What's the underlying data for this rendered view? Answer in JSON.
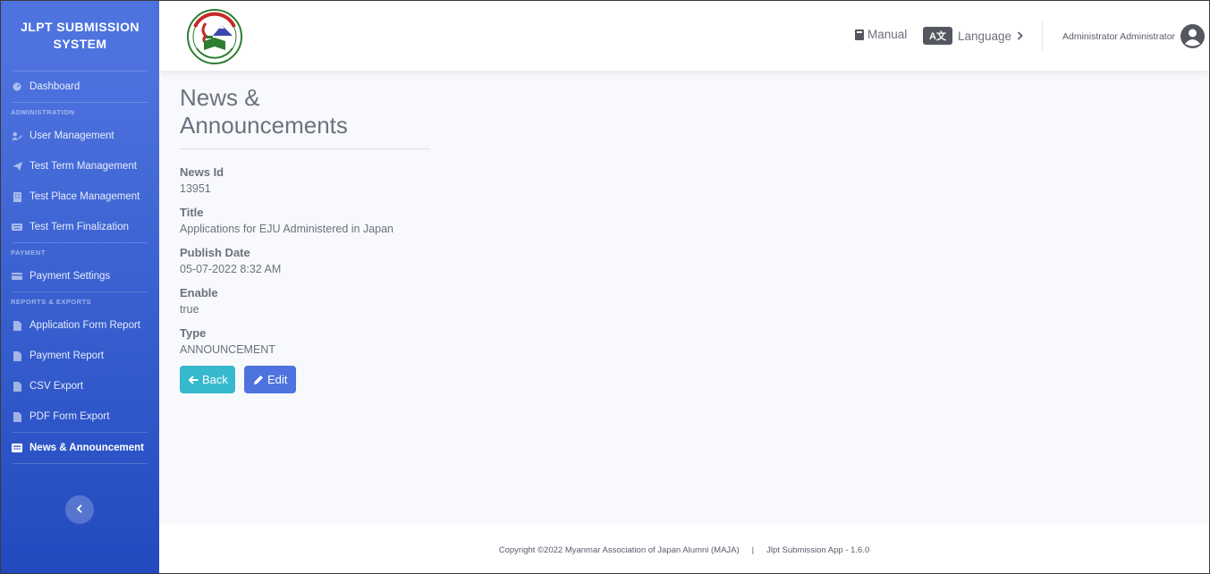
{
  "sidebar": {
    "brand": "JLPT SUBMISSION SYSTEM",
    "dashboard": {
      "label": "Dashboard",
      "icon": "dashboard-icon"
    },
    "sections": [
      {
        "heading": "ADMINISTRATION"
      },
      {
        "heading": "PAYMENT"
      },
      {
        "heading": "REPORTS & EXPORTS"
      }
    ],
    "admin_items": [
      {
        "label": "User Management",
        "icon": "user-edit-icon"
      },
      {
        "label": "Test Term Management",
        "icon": "paper-plane-icon"
      },
      {
        "label": "Test Place Management",
        "icon": "building-icon"
      },
      {
        "label": "Test Term Finalization",
        "icon": "keyboard-icon"
      }
    ],
    "payment_items": [
      {
        "label": "Payment Settings",
        "icon": "credit-card-icon"
      }
    ],
    "report_items": [
      {
        "label": "Application Form Report",
        "icon": "file-icon"
      },
      {
        "label": "Payment Report",
        "icon": "file-icon"
      },
      {
        "label": "CSV Export",
        "icon": "file-icon"
      },
      {
        "label": "PDF Form Export",
        "icon": "file-icon"
      }
    ],
    "active_item": {
      "label": "News & Announcement",
      "icon": "newspaper-icon"
    },
    "toggle_icon": "chevron-left-icon"
  },
  "topbar": {
    "manual_label": "Manual",
    "language_label": "Language",
    "language_badge": "A文",
    "user_name": "Administrator Administrator"
  },
  "page": {
    "title": "News & Announcements",
    "fields": [
      {
        "label": "News Id",
        "value": "13951"
      },
      {
        "label": "Title",
        "value": "Applications for EJU Administered in Japan"
      },
      {
        "label": "Publish Date",
        "value": "05-07-2022 8:32 AM"
      },
      {
        "label": "Enable",
        "value": "true"
      },
      {
        "label": "Type",
        "value": "ANNOUNCEMENT"
      }
    ],
    "back_label": "Back",
    "edit_label": "Edit"
  },
  "footer": {
    "copyright": "Copyright ©2022 Myanmar Association of Japan Alumni (MAJA)",
    "separator": "|",
    "app_version": "Jlpt Submission App - 1.6.0"
  },
  "colors": {
    "sidebar_top": "#4e73df",
    "sidebar_bottom": "#224abe",
    "back_button": "#36b9cc",
    "edit_button": "#4e73df",
    "page_bg": "#f8f9fc"
  }
}
